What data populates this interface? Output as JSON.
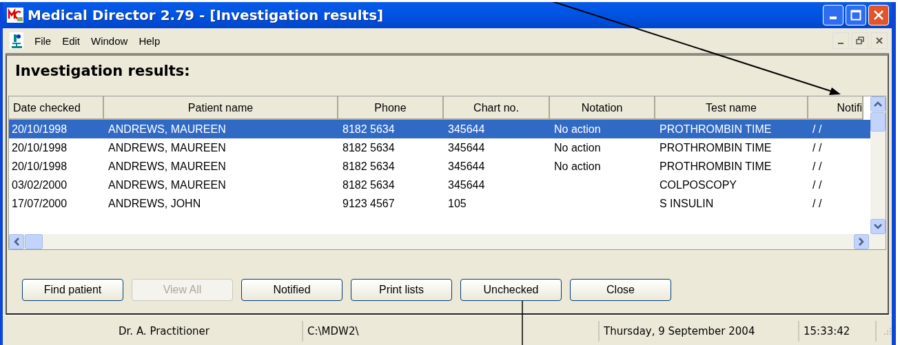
{
  "window": {
    "title": "Medical Director 2.79 - [Investigation results]"
  },
  "menu": [
    "File",
    "Edit",
    "Window",
    "Help"
  ],
  "heading": "Investigation results:",
  "table": {
    "columns": [
      {
        "label": "Date checked"
      },
      {
        "label": "Patient name"
      },
      {
        "label": "Phone"
      },
      {
        "label": "Chart no."
      },
      {
        "label": "Notation"
      },
      {
        "label": "Test name"
      },
      {
        "label": "Notifi"
      }
    ],
    "rows": [
      {
        "selected": true,
        "date": "20/10/1998",
        "patient": "ANDREWS, MAUREEN",
        "phone": "8182 5634",
        "chart": "345644",
        "notation": "No action",
        "test": "PROTHROMBIN TIME",
        "notified": "/ /"
      },
      {
        "selected": false,
        "date": "20/10/1998",
        "patient": "ANDREWS, MAUREEN",
        "phone": "8182 5634",
        "chart": "345644",
        "notation": "No action",
        "test": "PROTHROMBIN TIME",
        "notified": "/ /"
      },
      {
        "selected": false,
        "date": "20/10/1998",
        "patient": "ANDREWS, MAUREEN",
        "phone": "8182 5634",
        "chart": "345644",
        "notation": "No action",
        "test": "PROTHROMBIN TIME",
        "notified": "/ /"
      },
      {
        "selected": false,
        "date": "03/02/2000",
        "patient": "ANDREWS, MAUREEN",
        "phone": "8182 5634",
        "chart": "345644",
        "test": "COLPOSCOPY",
        "notified": "/ /"
      },
      {
        "selected": false,
        "date": "17/07/2000",
        "patient": "ANDREWS, JOHN",
        "phone": "9123 4567",
        "chart": "105",
        "test": "S INSULIN",
        "notified": "/ /"
      }
    ]
  },
  "buttons": [
    {
      "label": "Find patient",
      "disabled": false
    },
    {
      "label": "View All",
      "disabled": true
    },
    {
      "label": "Notified",
      "disabled": false
    },
    {
      "label": "Print lists",
      "disabled": false
    },
    {
      "label": "Unchecked",
      "disabled": false
    },
    {
      "label": "Close",
      "disabled": false
    }
  ],
  "status_bar": {
    "user": "Dr. A. Practitioner",
    "path": "C:\\MDW2\\",
    "date": "Thursday, 9 September 2004",
    "time": "15:33:42"
  }
}
